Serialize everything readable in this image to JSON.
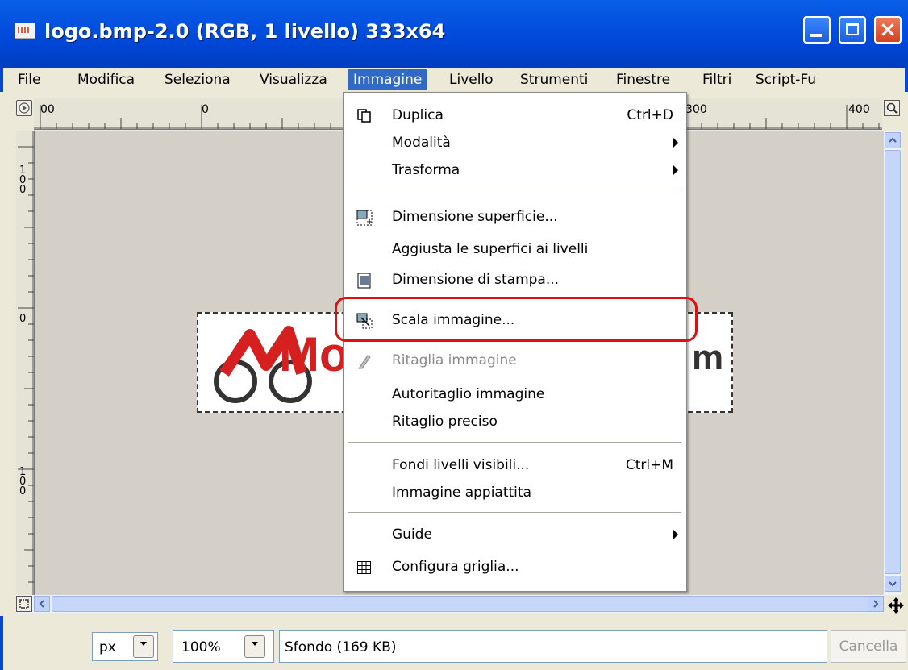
{
  "window": {
    "title": "logo.bmp-2.0 (RGB, 1 livello) 333x64",
    "controls": {
      "minimize": "minimize",
      "maximize": "maximize",
      "close": "×"
    }
  },
  "menubar": {
    "items": [
      "File",
      "Modifica",
      "Seleziona",
      "Visualizza",
      "Immagine",
      "Livello",
      "Strumenti",
      "Finestre",
      "Filtri",
      "Script-Fu"
    ],
    "active": "Immagine"
  },
  "ruler": {
    "top_labels": [
      "00",
      "0",
      "300",
      "400"
    ],
    "left_labels": [
      "1\n0\n0",
      "0",
      "1\n0\n0"
    ]
  },
  "canvas": {
    "logo_text_left": "Mo",
    "logo_text_right": "m"
  },
  "image_menu": {
    "items": [
      {
        "label": "Duplica",
        "shortcut": "Ctrl+D",
        "icon": "duplicate-icon"
      },
      {
        "label": "Modalità",
        "submenu": true
      },
      {
        "label": "Trasforma",
        "submenu": true
      },
      {
        "label": "Dimensione superficie...",
        "icon": "canvas-size-icon"
      },
      {
        "label": "Aggiusta le superfici ai livelli"
      },
      {
        "label": "Dimensione di stampa...",
        "icon": "print-size-icon"
      },
      {
        "label": "Scala immagine...",
        "icon": "scale-image-icon",
        "highlighted": true
      },
      {
        "label": "Ritaglia immagine",
        "icon": "crop-knife-icon",
        "disabled": true
      },
      {
        "label": "Autoritaglio immagine"
      },
      {
        "label": "Ritaglio preciso"
      },
      {
        "label": "Fondi livelli visibili...",
        "shortcut": "Ctrl+M"
      },
      {
        "label": "Immagine appiattita"
      },
      {
        "label": "Guide",
        "submenu": true
      },
      {
        "label": "Configura griglia...",
        "icon": "grid-icon"
      }
    ]
  },
  "statusbar": {
    "unit": "px",
    "zoom": "100%",
    "layer_info": "Sfondo (169 KB)",
    "cancel": "Cancella"
  },
  "colors": {
    "title_blue": "#0048d8",
    "menu_highlight": "#316ac5",
    "callout_red": "#e01010"
  }
}
